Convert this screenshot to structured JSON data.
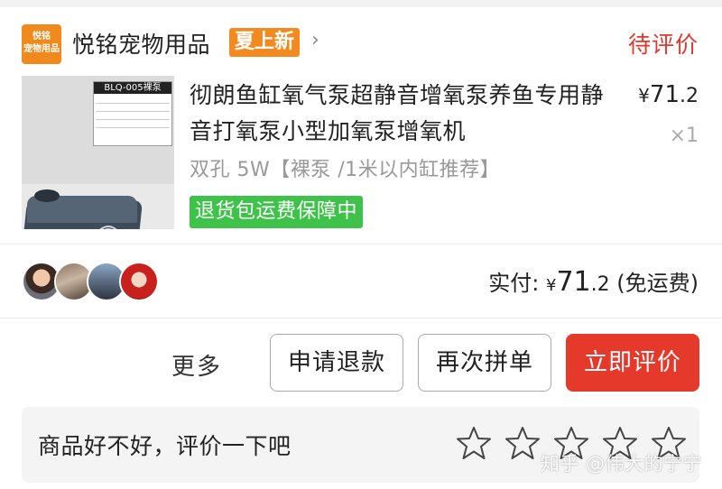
{
  "store": {
    "logo_text_1": "悦铭",
    "logo_text_2": "宠物用品",
    "name": "悦铭宠物用品",
    "tag": "夏上新",
    "chevron": "›",
    "status": "待评价"
  },
  "product": {
    "image_spec_title": "BLQ-005裸泵",
    "title": "彻朗鱼缸氧气泵超静音增氧泵养鱼专用静音打氧泵小型加氧泵增氧机",
    "price_symbol": "¥",
    "price_int": "71",
    "price_dec": ".2",
    "quantity": "×1",
    "sku": "双孔 5W【裸泵 /1米以内缸推荐】",
    "return_badge": "退货包运费保障中"
  },
  "payment": {
    "label": "实付:",
    "symbol": "¥",
    "amount_int": "71",
    "amount_dec": ".2",
    "shipping_note": "(免运费)"
  },
  "actions": {
    "more": "更多",
    "refund": "申请退款",
    "rebuy": "再次拼单",
    "review": "立即评价"
  },
  "review": {
    "prompt": "商品好不好，评价一下吧",
    "star_count": 5,
    "star_icon": "star-outline-icon"
  },
  "watermark": "知乎 @伟大的宁宁",
  "colors": {
    "accent_red": "#e53a2b",
    "status_red": "#e0362c",
    "store_orange": "#f08a1c",
    "badge_green": "#3ec24a"
  }
}
